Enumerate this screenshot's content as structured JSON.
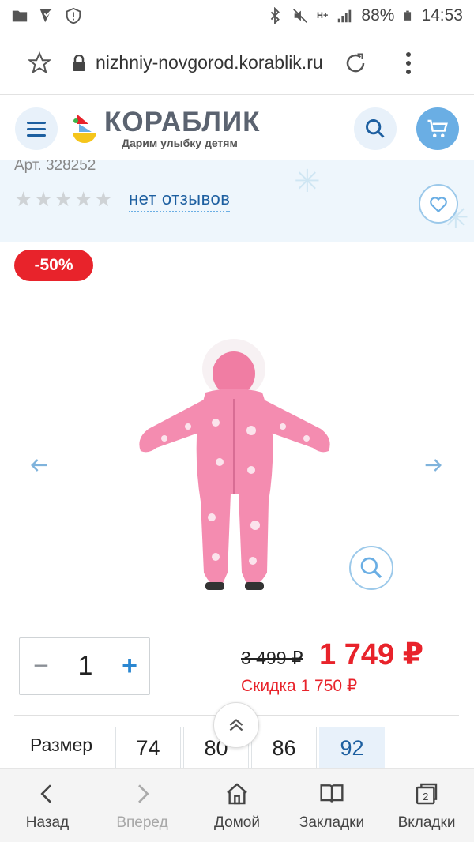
{
  "status_bar": {
    "battery": "88%",
    "time": "14:53",
    "network": "H+"
  },
  "browser": {
    "url": "nizhniy-novgorod.korablik.ru"
  },
  "site": {
    "logo_name": "КОРАБЛИК",
    "logo_slogan": "Дарим улыбку детям",
    "colors": {
      "brand_blue": "#1d5fa0",
      "accent_blue": "#6aaee4",
      "sale_red": "#e8232b"
    }
  },
  "product": {
    "article": "Арт. 328252",
    "rating_stars": 0,
    "reviews_link": "нет отзывов",
    "discount_badge": "-50%",
    "quantity": "1",
    "old_price": "3 499 ₽",
    "new_price": "1 749 ₽",
    "discount_text": "Скидка 1 750 ₽",
    "size_label": "Размер",
    "sizes": [
      "74",
      "80",
      "86",
      "92"
    ],
    "selected_size": "92"
  },
  "bottom_nav": {
    "items": [
      {
        "label": "Назад",
        "icon": "chevron-left-icon"
      },
      {
        "label": "Вперед",
        "icon": "chevron-right-icon"
      },
      {
        "label": "Домой",
        "icon": "home-icon"
      },
      {
        "label": "Закладки",
        "icon": "book-icon"
      },
      {
        "label": "Вкладки",
        "icon": "tabs-icon"
      }
    ],
    "tabs_count": "2"
  }
}
